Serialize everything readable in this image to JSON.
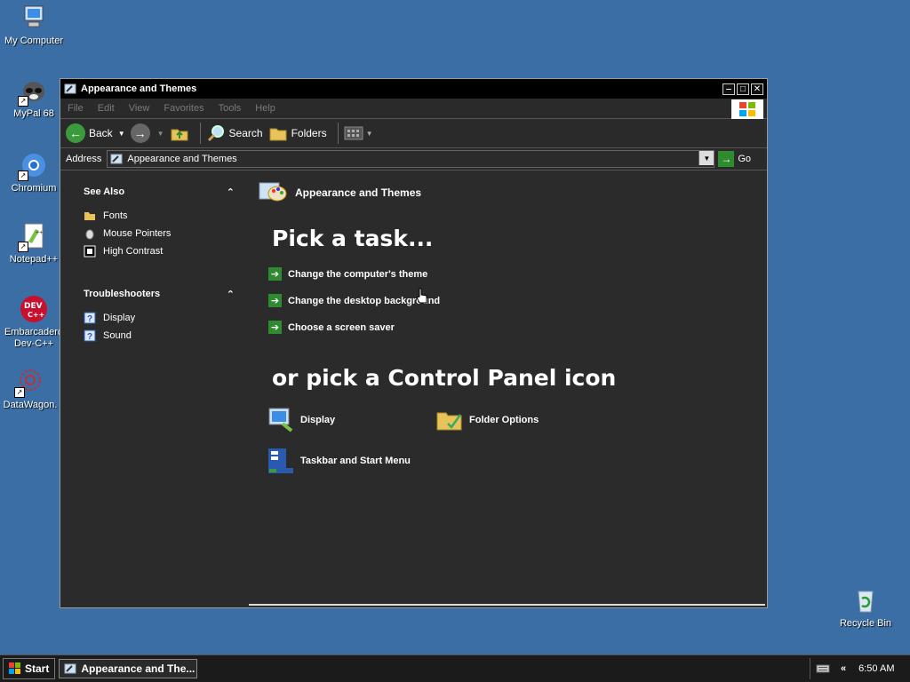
{
  "desktop": {
    "icons": [
      {
        "label": "My Computer"
      },
      {
        "label": "MyPal 68"
      },
      {
        "label": "Chromium"
      },
      {
        "label": "Notepad++"
      },
      {
        "label": "Embarcadero Dev-C++"
      },
      {
        "label": "DataWagon."
      },
      {
        "label": "Recycle Bin"
      }
    ]
  },
  "window": {
    "title": "Appearance and Themes",
    "menu": [
      "File",
      "Edit",
      "View",
      "Favorites",
      "Tools",
      "Help"
    ],
    "toolbar": {
      "back": "Back",
      "search": "Search",
      "folders": "Folders"
    },
    "address": {
      "label": "Address",
      "value": "Appearance and Themes",
      "go": "Go"
    },
    "sidebar": {
      "see_also": {
        "title": "See Also",
        "items": [
          "Fonts",
          "Mouse Pointers",
          "High Contrast"
        ]
      },
      "troubleshooters": {
        "title": "Troubleshooters",
        "items": [
          "Display",
          "Sound"
        ]
      }
    },
    "main": {
      "header": "Appearance and Themes",
      "pick_task": "Pick a task...",
      "tasks": [
        "Change the computer's theme",
        "Change the desktop background",
        "Choose a screen saver"
      ],
      "or_pick": "or pick a Control Panel icon",
      "icons": [
        "Display",
        "Folder Options",
        "Taskbar and Start Menu"
      ]
    }
  },
  "taskbar": {
    "start": "Start",
    "task_button": "Appearance and The...",
    "time": "6:50 AM"
  }
}
